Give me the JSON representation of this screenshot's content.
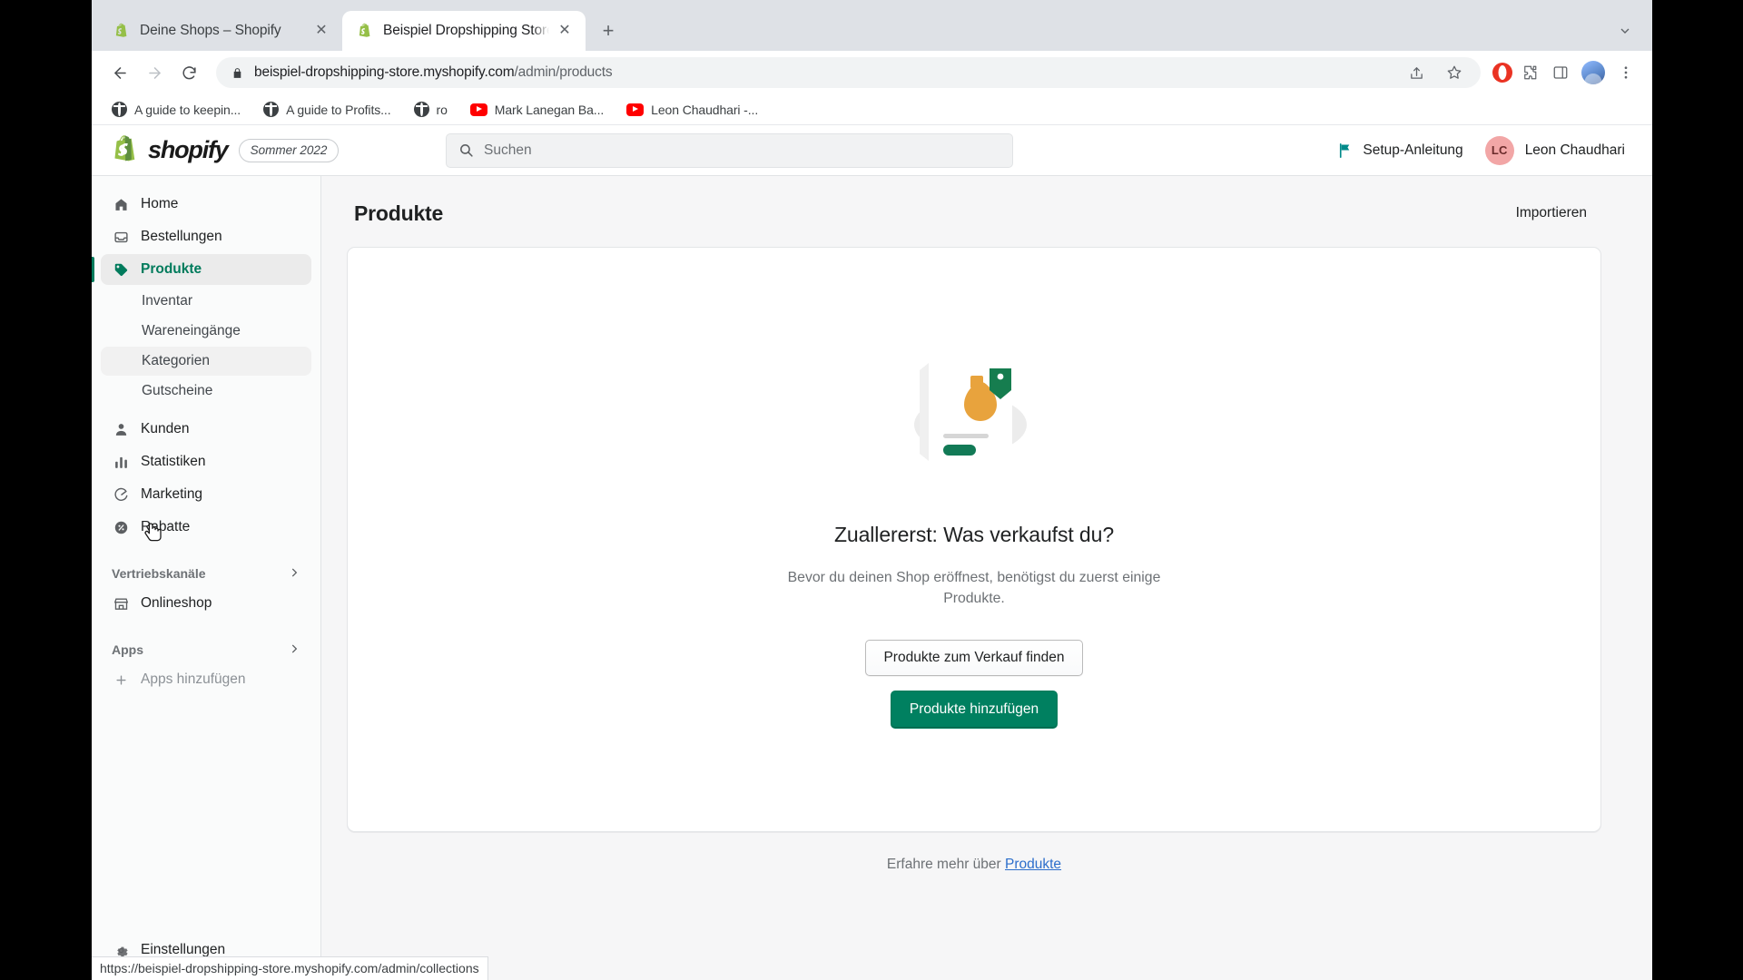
{
  "browser": {
    "tabs": [
      {
        "title": "Deine Shops – Shopify",
        "favicon": "shopify-favicon",
        "active": false,
        "close_label": "✕"
      },
      {
        "title": "Beispiel Dropshipping Store · P",
        "favicon": "shopify-favicon",
        "active": true,
        "close_label": "✕"
      }
    ],
    "new_tab_label": "+",
    "tab_list_chevron": "chevron-down-icon",
    "toolbar": {
      "back_label": "←",
      "forward_label": "→",
      "reload_label": "↻",
      "lock_icon": "lock-icon",
      "url_domain": "beispiel-dropshipping-store.myshopify.com",
      "url_path": "/admin/products",
      "share_icon": "share-icon",
      "bookmark_icon": "star-icon",
      "extension_icon": "puzzle-piece-icon",
      "sidepanel_icon": "side-panel-icon",
      "menu_icon": "three-dot-menu-icon",
      "profile_icon": "profile-avatar"
    },
    "bookmarks": [
      {
        "label": "A guide to keepin...",
        "icon": "globe-icon"
      },
      {
        "label": "A guide to Profits...",
        "icon": "globe-icon"
      },
      {
        "label": "ro",
        "icon": "globe-icon"
      },
      {
        "label": "Mark Lanegan Ba...",
        "icon": "youtube-icon"
      },
      {
        "label": "Leon Chaudhari -...",
        "icon": "youtube-icon"
      }
    ],
    "status_url": "https://beispiel-dropshipping-store.myshopify.com/admin/collections"
  },
  "header": {
    "logo_text": "shopify",
    "logo_icon": "shopify-bag-icon",
    "season_badge": "Sommer 2022",
    "search": {
      "placeholder": "Suchen",
      "icon": "search-icon",
      "value": ""
    },
    "setup_guide": {
      "label": "Setup-Anleitung",
      "icon": "flag-icon"
    },
    "user": {
      "initials": "LC",
      "name": "Leon Chaudhari"
    }
  },
  "sidebar": {
    "items": [
      {
        "label": "Home",
        "icon": "home-icon",
        "active": false
      },
      {
        "label": "Bestellungen",
        "icon": "orders-inbox-icon",
        "active": false
      },
      {
        "label": "Produkte",
        "icon": "products-tag-icon",
        "active": true
      }
    ],
    "sub_items": [
      {
        "label": "Inventar",
        "hovered": false
      },
      {
        "label": "Wareneingänge",
        "hovered": false
      },
      {
        "label": "Kategorien",
        "hovered": true
      },
      {
        "label": "Gutscheine",
        "hovered": false
      }
    ],
    "items_after": [
      {
        "label": "Kunden",
        "icon": "customers-person-icon",
        "active": false
      },
      {
        "label": "Statistiken",
        "icon": "analytics-bars-icon",
        "active": false
      },
      {
        "label": "Marketing",
        "icon": "marketing-target-icon",
        "active": false
      },
      {
        "label": "Rabatte",
        "icon": "discounts-icon",
        "active": false
      }
    ],
    "sales_channels": {
      "label": "Vertriebskanäle",
      "chevron": "chevron-right-icon"
    },
    "online_store": {
      "label": "Onlineshop",
      "icon": "storefront-icon"
    },
    "apps_section": {
      "label": "Apps",
      "chevron": "chevron-right-icon"
    },
    "add_apps": {
      "label": "Apps hinzufügen",
      "icon": "plus-icon"
    },
    "settings": {
      "label": "Einstellungen",
      "icon": "gear-icon"
    }
  },
  "main": {
    "page_title": "Produkte",
    "import_label": "Importieren",
    "empty_state": {
      "illustration": "product-placeholder-illustration",
      "title": "Zuallererst: Was verkaufst du?",
      "subtitle": "Bevor du deinen Shop eröffnest, benötigst du zuerst einige Produkte.",
      "secondary_button": "Produkte zum Verkauf finden",
      "primary_button": "Produkte hinzufügen"
    },
    "learn_more": {
      "prefix": "Erfahre mehr über ",
      "link": "Produkte"
    }
  },
  "colors": {
    "brand_green": "#008060",
    "active_green": "#007b5c",
    "link_blue": "#2c6ecb",
    "flag_teal": "#008a8a",
    "avatar_pink": "#f2a6a6"
  }
}
